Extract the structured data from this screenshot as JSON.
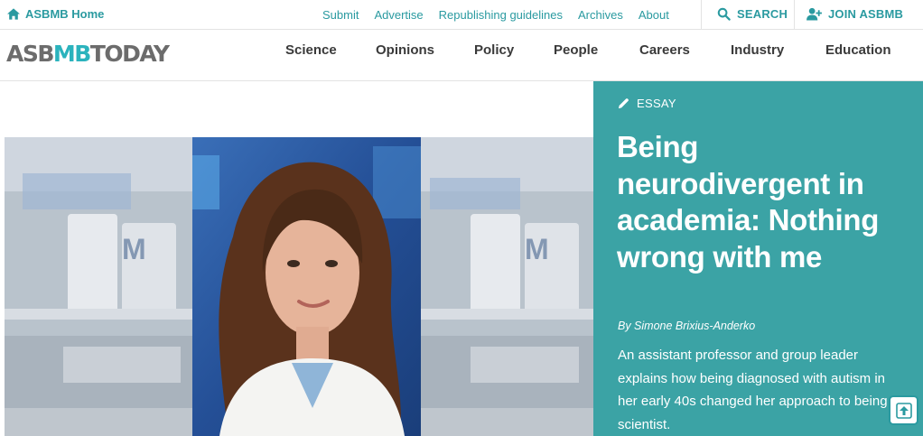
{
  "topbar": {
    "home_label": "ASBMB Home",
    "links": [
      "Submit",
      "Advertise",
      "Republishing guidelines",
      "Archives",
      "About"
    ],
    "search_label": "SEARCH",
    "join_label": "JOIN ASBMB"
  },
  "logo": {
    "part1": "ASB",
    "part2": "MB",
    "part3": "TODAY"
  },
  "nav": [
    "Science",
    "Opinions",
    "Policy",
    "People",
    "Careers",
    "Industry",
    "Education"
  ],
  "article": {
    "category": "ESSAY",
    "title": "Being neurodivergent in academia: Nothing wrong with me",
    "byline": "By Simone Brixius-Anderko",
    "summary": "An assistant professor and group leader explains how being diagnosed with autism in her early 40s changed her approach to being a scientist."
  },
  "colors": {
    "accent": "#2a9aa0",
    "panel": "#3ba3a5",
    "logo_gray": "#6c6c6c",
    "logo_teal": "#2bb3bd"
  },
  "icons": [
    "home-icon",
    "search-icon",
    "add-user-icon",
    "pencil-icon",
    "arrow-up-icon"
  ]
}
